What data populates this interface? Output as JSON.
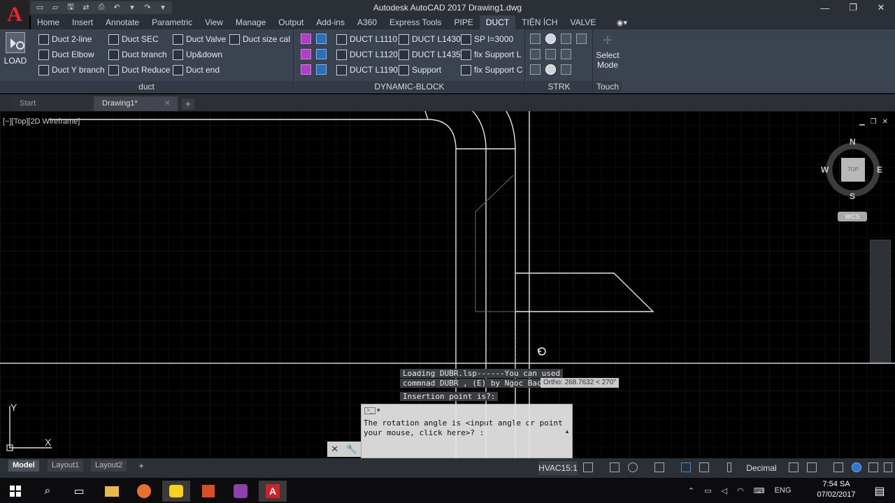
{
  "window": {
    "title": "Autodesk AutoCAD 2017    Drawing1.dwg",
    "minimize": "—",
    "maximize": "❐",
    "close": "✕",
    "logo_letter": "A"
  },
  "quick_access": [
    "▭",
    "▱",
    "🖫",
    "⇄",
    "⎙",
    "↶",
    "▾",
    "↷",
    "▾"
  ],
  "ribbon_tabs": [
    "Home",
    "Insert",
    "Annotate",
    "Parametric",
    "View",
    "Manage",
    "Output",
    "Add-ins",
    "A360",
    "Express Tools",
    "PIPE",
    "DUCT",
    "TIỆN ÍCH",
    "VALVE"
  ],
  "active_tab": "DUCT",
  "panels": {
    "duct": {
      "title": "duct",
      "load_label": "LOAD",
      "buttons": [
        "Duct 2-line",
        "Duct SEC",
        "Duct Valve",
        "Duct size cal",
        "Duct Elbow",
        "Duct branch",
        "Up&down",
        "Duct Y branch",
        "Duct Reduce",
        "Duct end"
      ]
    },
    "dynamic_block": {
      "title": "DYNAMIC-BLOCK",
      "buttons": [
        "DUCT L1110",
        "DUCT L1430",
        "SP I=3000",
        "DUCT L1120",
        "DUCT L1435",
        "fix Support L",
        "DUCT L1190",
        "Support",
        "fix Support C"
      ]
    },
    "strk": {
      "title": "STRK"
    },
    "touch": {
      "title": "Touch",
      "select_mode": "Select Mode"
    }
  },
  "file_tabs": {
    "start": "Start",
    "drawing": "Drawing1*",
    "close": "✕",
    "add": "+"
  },
  "viewport": {
    "label": "[−][Top][2D Wireframe]",
    "controls": [
      "▁",
      "❐",
      "✕"
    ],
    "viewcube": {
      "n": "N",
      "s": "S",
      "e": "E",
      "w": "W",
      "face": "TOP"
    },
    "wcs": "WCS",
    "ucs_y": "Y",
    "ucs_x": "X"
  },
  "command": {
    "history_1": "  Loading DUBR.lsp------You can used",
    "history_2": "commnad DUBR , (E) by Ngoc Bac",
    "history_3": "Insertion point is?:",
    "ortho": "Ortho: 268.7632 < 270°",
    "prompt": "The rotation angle is <input angle or point your mouse, click here>? :",
    "prompt_icon": ">_",
    "tools": [
      "✕",
      "🔧"
    ]
  },
  "layout_tabs": {
    "model": "Model",
    "layout1": "Layout1",
    "layout2": "Layout2",
    "add": "+"
  },
  "status": {
    "hvac": "HVAC15:1",
    "units": "Decimal"
  },
  "taskbar": {
    "lang": "ENG",
    "time": "7:54 SA",
    "date": "07/02/2017"
  }
}
